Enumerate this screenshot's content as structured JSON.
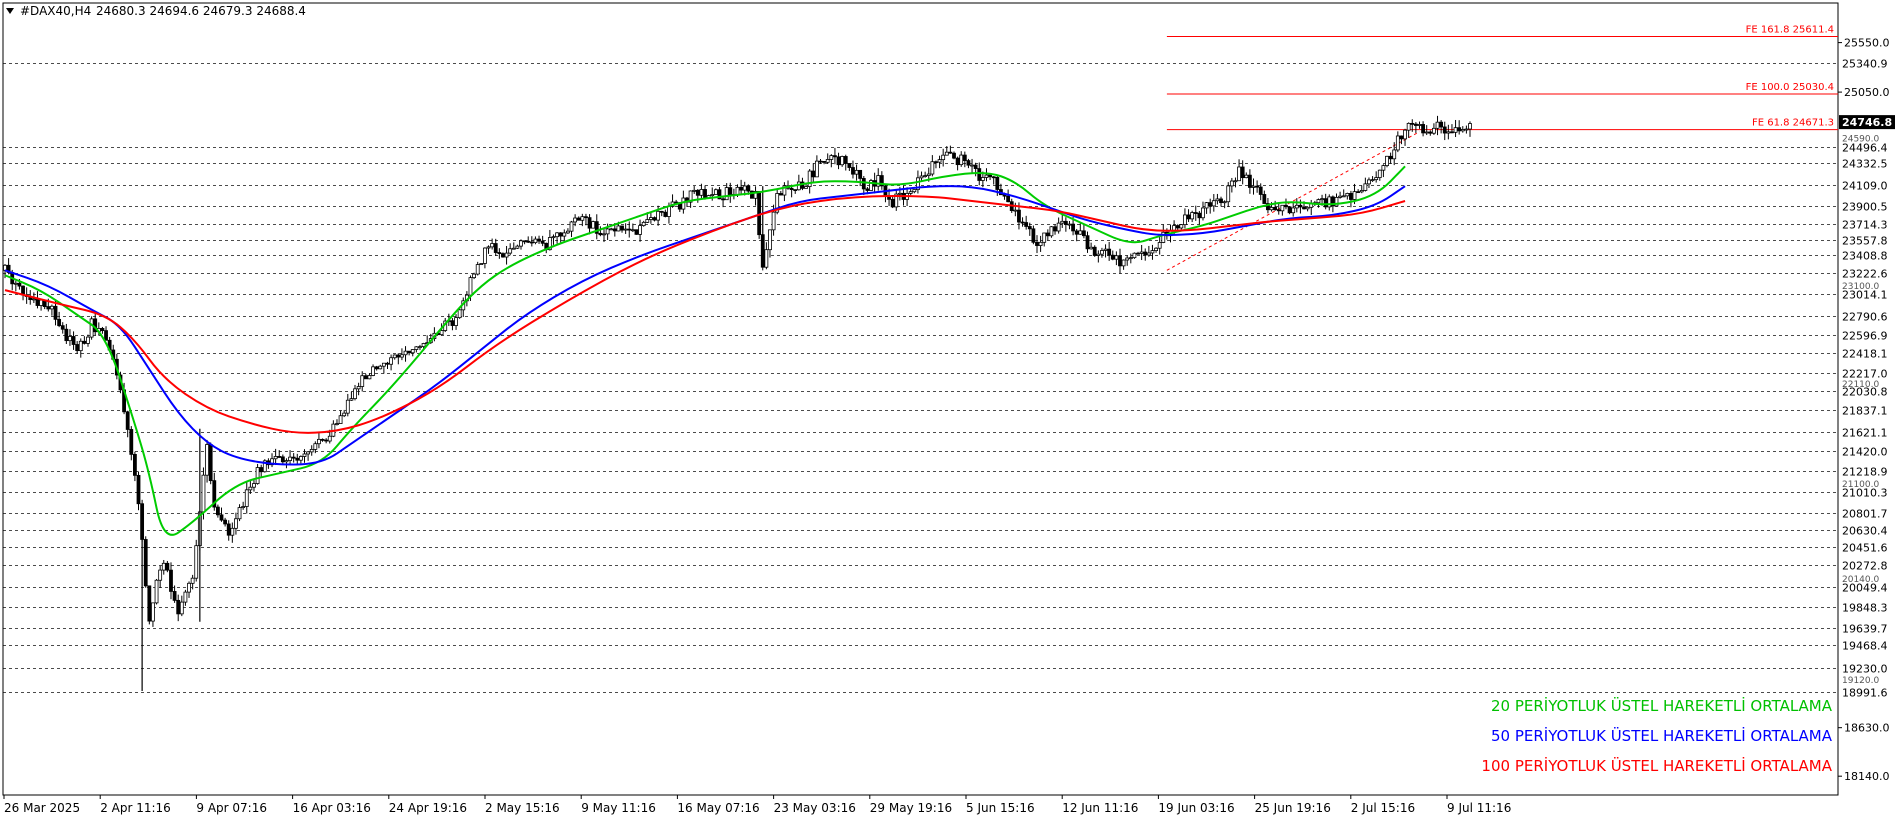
{
  "header": {
    "symbol": "#DAX40,H4",
    "ohlc": "24680.3 24694.6 24679.3 24688.4",
    "menu_icon": "triangle-down-icon"
  },
  "legend": [
    {
      "text": "20 PERİYOTLUK ÜSTEL HAREKETLİ ORTALAMA",
      "color": "#00c000"
    },
    {
      "text": "50 PERİYOTLUK ÜSTEL HAREKETLİ ORTALAMA",
      "color": "#0000ff"
    },
    {
      "text": "100 PERİYOTLUK ÜSTEL HAREKETLİ ORTALAMA",
      "color": "#ff0000"
    }
  ],
  "colors": {
    "background": "#ffffff",
    "grid": "#000000",
    "candles": "#000000",
    "fib": "#ff0000",
    "current_price_bg": "#000000"
  },
  "chart_data": {
    "type": "line",
    "title": "#DAX40,H4",
    "ylim": [
      17950,
      25950
    ],
    "axis_labels": [
      25550.0,
      25050.0,
      18630.0,
      18140.0
    ],
    "current_price": 24746.8,
    "level_lines": [
      25340.9,
      24496.4,
      24332.5,
      24109.0,
      23900.5,
      23714.3,
      23557.8,
      23408.8,
      23222.6,
      23014.1,
      22790.6,
      22596.9,
      22418.1,
      22217.0,
      22030.8,
      21837.1,
      21621.1,
      21420.0,
      21218.9,
      21010.3,
      20801.7,
      20630.4,
      20451.6,
      20272.8,
      20049.4,
      19848.3,
      19639.7,
      19468.4,
      19230.0,
      18991.6
    ],
    "partial_labels": [
      "24590.0",
      "23100.0",
      "22110.0",
      "21100.0",
      "20140.0",
      "19120.0"
    ],
    "fib_levels": [
      {
        "label": "FE 161.8 25611.4",
        "value": 25611.4
      },
      {
        "label": "FE 100.0 25030.4",
        "value": 25030.4
      },
      {
        "label": "FE 61.8 24671.3",
        "value": 24671.3
      }
    ],
    "x_ticks": [
      "26 Mar 2025",
      "2 Apr 11:16",
      "9 Apr 07:16",
      "16 Apr 03:16",
      "24 Apr 19:16",
      "2 May 15:16",
      "9 May 11:16",
      "16 May 07:16",
      "23 May 03:16",
      "29 May 19:16",
      "5 Jun 15:16",
      "12 Jun 11:16",
      "19 Jun 03:16",
      "25 Jun 19:16",
      "2 Jul 15:16",
      "9 Jul 11:16"
    ],
    "x_range": [
      0,
      203
    ],
    "price_anchors": [
      [
        0,
        23250
      ],
      [
        3,
        23000
      ],
      [
        6,
        22900
      ],
      [
        8,
        22650
      ],
      [
        10,
        22400
      ],
      [
        12,
        22700
      ],
      [
        14,
        22550
      ],
      [
        16,
        22050
      ],
      [
        18,
        21200
      ],
      [
        19,
        20500
      ],
      [
        20,
        19700
      ],
      [
        21,
        20100
      ],
      [
        22,
        20300
      ],
      [
        24,
        19800
      ],
      [
        26,
        20200
      ],
      [
        28,
        21500
      ],
      [
        29,
        20800
      ],
      [
        31,
        20600
      ],
      [
        33,
        20900
      ],
      [
        35,
        21200
      ],
      [
        37,
        21350
      ],
      [
        40,
        21300
      ],
      [
        42,
        21450
      ],
      [
        44,
        21500
      ],
      [
        46,
        21700
      ],
      [
        48,
        22000
      ],
      [
        50,
        22200
      ],
      [
        54,
        22350
      ],
      [
        58,
        22550
      ],
      [
        62,
        22750
      ],
      [
        65,
        23200
      ],
      [
        67,
        23500
      ],
      [
        69,
        23400
      ],
      [
        72,
        23600
      ],
      [
        75,
        23500
      ],
      [
        78,
        23700
      ],
      [
        80,
        23800
      ],
      [
        82,
        23650
      ],
      [
        85,
        23700
      ],
      [
        88,
        23650
      ],
      [
        90,
        23800
      ],
      [
        93,
        23900
      ],
      [
        96,
        24050
      ],
      [
        99,
        24000
      ],
      [
        102,
        24100
      ],
      [
        104,
        24000
      ],
      [
        105,
        23300
      ],
      [
        107,
        24000
      ],
      [
        109,
        24100
      ],
      [
        111,
        24150
      ],
      [
        113,
        24350
      ],
      [
        115,
        24400
      ],
      [
        117,
        24300
      ],
      [
        119,
        24100
      ],
      [
        121,
        24150
      ],
      [
        123,
        23950
      ],
      [
        125,
        24050
      ],
      [
        127,
        24150
      ],
      [
        129,
        24350
      ],
      [
        131,
        24400
      ],
      [
        133,
        24350
      ],
      [
        135,
        24200
      ],
      [
        137,
        24150
      ],
      [
        139,
        23950
      ],
      [
        141,
        23700
      ],
      [
        143,
        23550
      ],
      [
        145,
        23650
      ],
      [
        147,
        23700
      ],
      [
        149,
        23600
      ],
      [
        151,
        23450
      ],
      [
        153,
        23400
      ],
      [
        155,
        23300
      ],
      [
        157,
        23450
      ],
      [
        159,
        23400
      ],
      [
        161,
        23650
      ],
      [
        163,
        23750
      ],
      [
        165,
        23800
      ],
      [
        167,
        23900
      ],
      [
        169,
        24000
      ],
      [
        171,
        24250
      ],
      [
        173,
        24100
      ],
      [
        175,
        23900
      ],
      [
        177,
        23850
      ],
      [
        179,
        23850
      ],
      [
        181,
        23900
      ],
      [
        183,
        23950
      ],
      [
        185,
        23950
      ],
      [
        187,
        24050
      ],
      [
        189,
        24150
      ],
      [
        191,
        24300
      ],
      [
        193,
        24550
      ],
      [
        195,
        24750
      ],
      [
        196,
        24688
      ]
    ],
    "series": [
      {
        "name": "20 PERİYOTLUK ÜSTEL HAREKETLİ ORTALAMA",
        "color": "#00cc00",
        "x": [
          0,
          5,
          10,
          14,
          18,
          20,
          22,
          26,
          32,
          38,
          44,
          48,
          54,
          62,
          66,
          70,
          76,
          82,
          88,
          94,
          100,
          106,
          112,
          118,
          124,
          130,
          136,
          140,
          144,
          150,
          156,
          160,
          166,
          170,
          174,
          178,
          184,
          190,
          194
        ],
        "values": [
          23200,
          23050,
          22800,
          22600,
          21700,
          21200,
          20500,
          20700,
          21100,
          21200,
          21300,
          21650,
          22100,
          22800,
          23100,
          23300,
          23500,
          23650,
          23800,
          23950,
          24000,
          24050,
          24150,
          24150,
          24100,
          24200,
          24250,
          24150,
          23900,
          23700,
          23500,
          23600,
          23700,
          23800,
          23900,
          23950,
          23900,
          24000,
          24300
        ]
      },
      {
        "name": "50 PERİYOTLUK ÜSTEL HAREKETLİ ORTALAMA",
        "color": "#0000ff",
        "x": [
          0,
          6,
          12,
          16,
          20,
          24,
          28,
          32,
          38,
          44,
          48,
          54,
          60,
          66,
          72,
          80,
          88,
          96,
          104,
          110,
          116,
          122,
          128,
          134,
          140,
          146,
          150,
          156,
          160,
          166,
          172,
          178,
          184,
          190,
          194
        ],
        "values": [
          23250,
          23100,
          22850,
          22700,
          22250,
          21800,
          21500,
          21350,
          21280,
          21300,
          21500,
          21800,
          22100,
          22450,
          22800,
          23150,
          23400,
          23600,
          23800,
          23950,
          24000,
          24050,
          24100,
          24100,
          24000,
          23850,
          23750,
          23650,
          23600,
          23620,
          23700,
          23780,
          23800,
          23900,
          24100
        ]
      },
      {
        "name": "100 PERİYOTLUK ÜSTEL HAREKETLİ ORTALAMA",
        "color": "#ff0000",
        "x": [
          0,
          8,
          14,
          18,
          22,
          28,
          34,
          40,
          46,
          52,
          60,
          68,
          78,
          88,
          98,
          108,
          118,
          128,
          134,
          140,
          146,
          152,
          158,
          164,
          170,
          176,
          182,
          188,
          194
        ],
        "values": [
          23050,
          22900,
          22800,
          22550,
          22150,
          21850,
          21700,
          21600,
          21620,
          21750,
          22050,
          22500,
          22950,
          23350,
          23650,
          23900,
          24000,
          24000,
          23950,
          23900,
          23850,
          23750,
          23650,
          23650,
          23700,
          23750,
          23780,
          23820,
          23950
        ]
      }
    ]
  }
}
